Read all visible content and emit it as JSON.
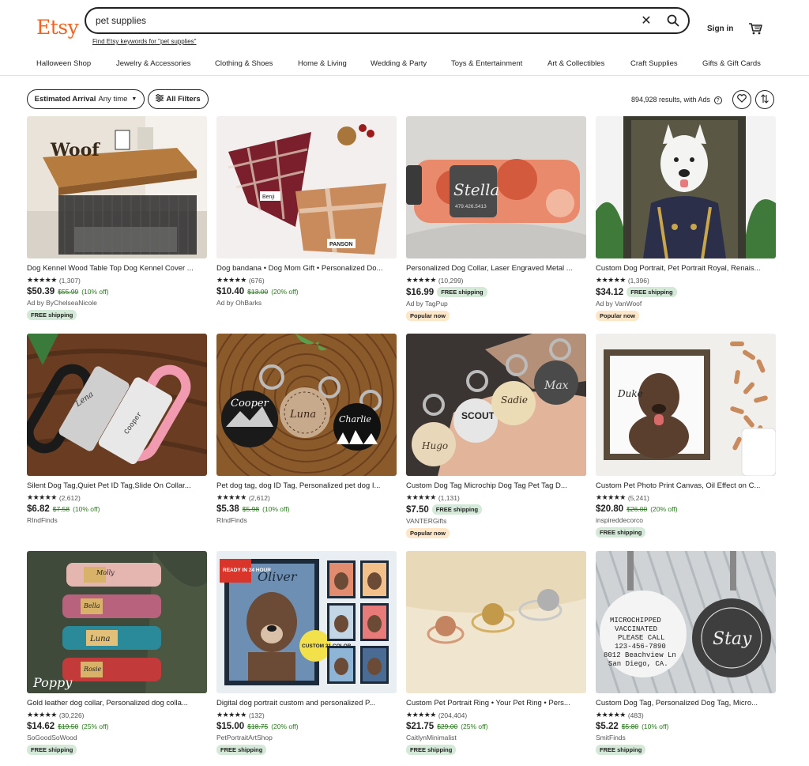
{
  "header": {
    "logo": "Etsy",
    "search_value": "pet supplies",
    "suggest_link": "Find Etsy keywords for \"pet supplies\"",
    "sign_in": "Sign in"
  },
  "nav": [
    "Halloween Shop",
    "Jewelry & Accessories",
    "Clothing & Shoes",
    "Home & Living",
    "Wedding & Party",
    "Toys & Entertainment",
    "Art & Collectibles",
    "Craft Supplies",
    "Gifts & Gift Cards"
  ],
  "filters": {
    "arrival_label": "Estimated Arrival",
    "arrival_value": "Any time",
    "all_filters": "All Filters",
    "results": "894,928 results, with Ads"
  },
  "colors": {
    "brand": "#f1641e",
    "discount": "#2a7a1d",
    "ship_badge": "#d4e9d7",
    "popular_badge": "#fde7c8"
  },
  "listings": [
    {
      "title": "Dog Kennel Wood Table Top Dog Kennel Cover ...",
      "stars": "★★★★★",
      "count": "(1,307)",
      "price": "$50.39",
      "orig": "$55.99",
      "disc": "(10% off)",
      "seller": "Ad by ByChelseaNicole",
      "badge": "FREE shipping",
      "badge_type": "ship",
      "inline_badge": ""
    },
    {
      "title": "Dog bandana • Dog Mom Gift • Personalized Do...",
      "stars": "★★★★★",
      "count": "(676)",
      "price": "$10.40",
      "orig": "$13.00",
      "disc": "(20% off)",
      "seller": "Ad by OhBarks",
      "badge": "",
      "badge_type": "",
      "inline_badge": ""
    },
    {
      "title": "Personalized Dog Collar, Laser Engraved Metal ...",
      "stars": "★★★★★",
      "count": "(10,299)",
      "price": "$16.99",
      "orig": "",
      "disc": "",
      "seller": "Ad by TagPup",
      "badge": "Popular now",
      "badge_type": "pop",
      "inline_badge": "FREE shipping"
    },
    {
      "title": "Custom Dog Portrait, Pet Portrait Royal, Renais...",
      "stars": "★★★★★",
      "count": "(1,396)",
      "price": "$34.12",
      "orig": "",
      "disc": "",
      "seller": "Ad by VanWoof",
      "badge": "Popular now",
      "badge_type": "pop",
      "inline_badge": "FREE shipping"
    },
    {
      "title": "Silent Dog Tag,Quiet Pet ID Tag,Slide On Collar...",
      "stars": "★★★★★",
      "count": "(2,612)",
      "price": "$6.82",
      "orig": "$7.58",
      "disc": "(10% off)",
      "seller": "RIndFinds",
      "badge": "",
      "badge_type": "",
      "inline_badge": ""
    },
    {
      "title": "Pet dog tag, dog ID Tag, Personalized pet dog I...",
      "stars": "★★★★★",
      "count": "(2,612)",
      "price": "$5.38",
      "orig": "$5.98",
      "disc": "(10% off)",
      "seller": "RIndFinds",
      "badge": "",
      "badge_type": "",
      "inline_badge": ""
    },
    {
      "title": "Custom Dog Tag Microchip Dog Tag Pet Tag D...",
      "stars": "★★★★★",
      "count": "(1,131)",
      "price": "$7.50",
      "orig": "",
      "disc": "",
      "seller": "VANTERGifts",
      "badge": "Popular now",
      "badge_type": "pop",
      "inline_badge": "FREE shipping"
    },
    {
      "title": "Custom Pet Photo Print Canvas, Oil Effect on C...",
      "stars": "★★★★★",
      "count": "(5,241)",
      "price": "$20.80",
      "orig": "$26.00",
      "disc": "(20% off)",
      "seller": "inspireddecorco",
      "badge": "FREE shipping",
      "badge_type": "ship",
      "inline_badge": ""
    },
    {
      "title": "Gold leather dog collar, Personalized dog colla...",
      "stars": "★★★★★",
      "count": "(30,226)",
      "price": "$14.62",
      "orig": "$19.50",
      "disc": "(25% off)",
      "seller": "SoGoodSoWood",
      "badge": "FREE shipping",
      "badge_type": "ship",
      "inline_badge": ""
    },
    {
      "title": "Digital dog portrait custom and personalized P...",
      "stars": "★★★★★",
      "count": "(132)",
      "price": "$15.00",
      "orig": "$18.75",
      "disc": "(20% off)",
      "seller": "PetPortraitArtShop",
      "badge": "FREE shipping",
      "badge_type": "ship",
      "inline_badge": ""
    },
    {
      "title": "Custom Pet Portrait Ring • Your Pet Ring • Pers...",
      "stars": "★★★★★",
      "count": "(204,404)",
      "price": "$21.75",
      "orig": "$29.00",
      "disc": "(25% off)",
      "seller": "CaitlynMinimalist",
      "badge": "FREE shipping",
      "badge_type": "ship",
      "inline_badge": ""
    },
    {
      "title": "Custom Dog Tag, Personalized Dog Tag, Micro...",
      "stars": "★★★★★",
      "count": "(483)",
      "price": "$5.22",
      "orig": "$5.80",
      "disc": "(10% off)",
      "seller": "SmitFinds",
      "badge": "FREE shipping",
      "badge_type": "ship",
      "inline_badge": ""
    }
  ],
  "image_text": {
    "woof": "Woof",
    "bandana_tag1": "Benji",
    "bandana_tag2": "PANSON",
    "collar_name": "Stella",
    "collar_phone": "479.426.5413",
    "silent_name1": "Lena",
    "silent_name2": "Cooper",
    "tag_cooper": "Cooper",
    "tag_luna": "Luna",
    "tag_charlie": "Charlie",
    "tag_hugo": "Hugo",
    "tag_scout": "SCOUT",
    "tag_sadie": "Sadie",
    "tag_max": "Max",
    "canvas_name": "Duke",
    "collar_molly": "Molly",
    "collar_bella": "Bella",
    "collar_luna": "Luna",
    "collar_rosie": "Rosie",
    "poppy": "Poppy",
    "ready_badge": "READY IN 24 HOUR",
    "portrait_name": "Oliver",
    "custom_badge": "CUSTOM 21 COLOR",
    "tag_text1": "MICROCHIPPED",
    "tag_text2": "VACCINATED",
    "tag_text3": "PLEASE CALL",
    "tag_text4": "123-456-7890",
    "tag_text5": "8012 Beachview Ln",
    "tag_text6": "San Diego, CA.",
    "tag_stay": "Stay"
  }
}
